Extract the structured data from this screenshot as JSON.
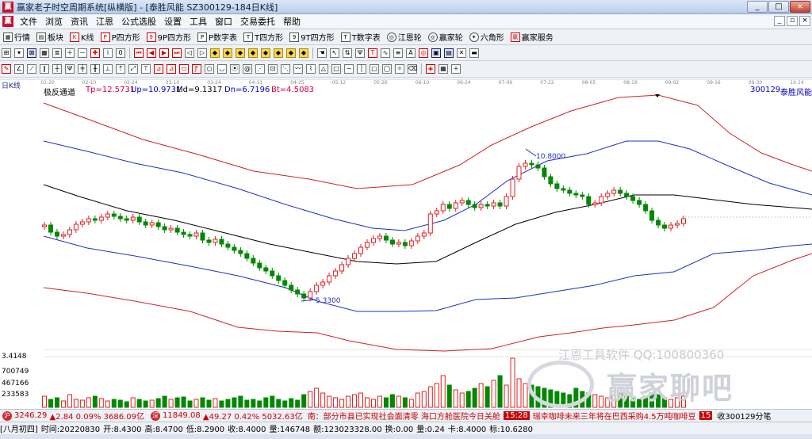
{
  "window": {
    "title": "赢家老子时空周期系统[纵横版] - [泰胜风能  SZ300129-184日K线]",
    "min": "_",
    "max": "□",
    "close": "×"
  },
  "menu": {
    "items": [
      "文件",
      "浏览",
      "资讯",
      "江恩",
      "公式选股",
      "设置",
      "工具",
      "窗口",
      "交易委托",
      "帮助"
    ]
  },
  "toolbar1": {
    "items": [
      "行情",
      "板块",
      "K线",
      "P四方形",
      "9P四方形",
      "P数字表",
      "T四方形",
      "9T四方形",
      "T数字表",
      "江恩轮",
      "赢家轮",
      "六角形",
      "赢家服务"
    ]
  },
  "chart": {
    "period_label": "日K线",
    "indicator_name": "极反通道",
    "tp": "Tp=12.5731",
    "up": "Up=10.9731",
    "md": "Md=9.1317",
    "dn": "Dn=6.7196",
    "bt": "Bt=4.5083",
    "stock_code": "300129",
    "stock_name": "泰胜风能",
    "high_label": "10.8000",
    "low_label": "5.3300",
    "date_ticks": [
      "01-20",
      "02-10",
      "02-24",
      "03-10",
      "03-24",
      "04-11",
      "04-25",
      "05-12",
      "05-26",
      "06-10",
      "06-24",
      "07-06",
      "07-22",
      "08-05",
      "08-19",
      "09-02",
      "09-16",
      "09-30",
      "10-14"
    ],
    "volume_labels": [
      "3.4148",
      "700749",
      "467166",
      "233583"
    ]
  },
  "watermark": {
    "brand_line": "江恩工具软件  QQ:100800360",
    "big_text": "赢家聊吧",
    "url": "liaoba.yici360.com"
  },
  "status_bar": {
    "sh_icon": "沪",
    "sh_index": "3246.29",
    "sh_change": "▲2.84 0.09% 3686.09亿",
    "sz_icon": "深",
    "sz_index": "11849.08",
    "sz_change": "▲49.27 0.42% 5032.63亿",
    "news1": "南：部分市县已实现社会面清零 海口方舱医院今日关舱",
    "news_time": "15:28",
    "news2": "瑞幸咖啡未来三年将在巴西采购4.5万吨咖啡豆",
    "badge": "15",
    "right_msg": "收300129分笔"
  },
  "status_bar2": {
    "date_tag": "[八月初四]",
    "time": "时间:20220830",
    "open": "开:8.4300",
    "high": "高:8.4700",
    "low": "低:8.2900",
    "close": "收:8.4000",
    "vol": "量:146748",
    "amount": "额:123023328.00",
    "change": "换:0.00",
    "amp": "量:0.24",
    "mid": "卡:8.4000",
    "target": "标:10.6280"
  },
  "chart_data": {
    "type": "candlestick",
    "title": "泰胜风能 300129 日K线 - 极反通道",
    "indicator": {
      "Tp": 12.5731,
      "Up": 10.9731,
      "Md": 9.1317,
      "Dn": 6.7196,
      "Bt": 4.5083
    },
    "annotations": [
      {
        "label": "10.8000",
        "type": "high"
      },
      {
        "label": "5.3300",
        "type": "low"
      }
    ],
    "price_range_estimate": [
      4.0,
      13.0
    ],
    "last_close": 8.4
  }
}
